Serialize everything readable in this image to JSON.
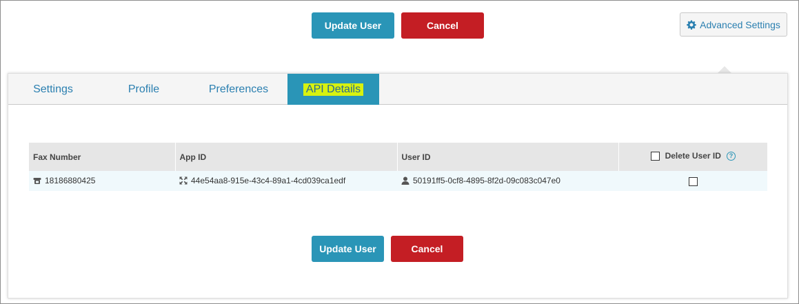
{
  "top_actions": {
    "update_label": "Update User",
    "cancel_label": "Cancel"
  },
  "advanced": {
    "label": "Advanced Settings",
    "icon": "gear-icon"
  },
  "tabs": [
    {
      "label": "Settings",
      "active": false
    },
    {
      "label": "Profile",
      "active": false
    },
    {
      "label": "Preferences",
      "active": false
    },
    {
      "label": "API Details",
      "active": true
    }
  ],
  "table": {
    "headers": [
      "Fax Number",
      "App ID",
      "User ID",
      "Delete User ID"
    ],
    "rows": [
      {
        "fax_number": "18186880425",
        "app_id": "44e54aa8-915e-43c4-89a1-4cd039ca1edf",
        "user_id": "50191ff5-0cf8-4895-8f2d-09c083c047e0",
        "delete_checked": false
      }
    ]
  },
  "bottom_actions": {
    "update_label": "Update User",
    "cancel_label": "Cancel"
  },
  "colors": {
    "primary": "#2a95b7",
    "danger": "#c41e24",
    "link": "#2a7fb0",
    "highlight": "#d7f20f"
  }
}
